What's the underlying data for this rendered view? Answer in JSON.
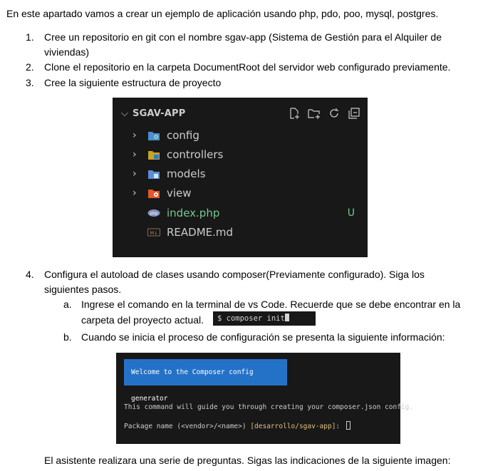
{
  "intro": "En este apartado vamos a crear un ejemplo de aplicación usando php, pdo, poo, mysql, postgres.",
  "steps": [
    {
      "num": "1.",
      "line1": "Cree un repositorio en git con el nombre sgav-app (Sistema de Gestión para el Alquiler de",
      "line2": "viviendas)"
    },
    {
      "num": "2.",
      "line1": "Clone el repositorio en la carpeta DocumentRoot del servidor web configurado previamente."
    },
    {
      "num": "3.",
      "line1": "Cree la siguiente estructura de proyecto"
    },
    {
      "num": "4.",
      "line1": "Configura el autoload de clases usando composer(Previamente configurado). Siga los",
      "line2": "siguientes pasos."
    }
  ],
  "substeps": [
    {
      "letter": "a.",
      "line1": "Ingrese el comando en la terminal de vs Code. Recuerde que se debe encontrar en la",
      "line2": "carpeta del proyecto actual."
    },
    {
      "letter": "b.",
      "line1": "Cuando se inicia el proceso de configuración se presenta la siguiente información:"
    }
  ],
  "explorer": {
    "title": "SGAV-APP",
    "items": [
      {
        "label": "config",
        "icon": "folder-config-icon",
        "color": "#cccccc"
      },
      {
        "label": "controllers",
        "icon": "folder-controllers-icon",
        "color": "#cccccc"
      },
      {
        "label": "models",
        "icon": "folder-models-icon",
        "color": "#cccccc"
      },
      {
        "label": "view",
        "icon": "folder-view-icon",
        "color": "#cccccc"
      },
      {
        "label": "index.php",
        "icon": "php-file-icon",
        "color": "#73c991",
        "badge": "U"
      },
      {
        "label": "README.md",
        "icon": "markdown-file-icon",
        "color": "#cccccc"
      }
    ]
  },
  "terminal_command": "$ composer init",
  "composer": {
    "welcome": "Welcome to the Composer config generator",
    "guide": "This command will guide you through creating your composer.json config.",
    "package_prompt": "Package name (<vendor>/<name>) ",
    "package_default": "[desarrollo/sgav-app]",
    "package_suffix": ": "
  },
  "outro": "El asistente realizara una serie de preguntas. Sigas las indicaciones de la siguiente imagen:"
}
